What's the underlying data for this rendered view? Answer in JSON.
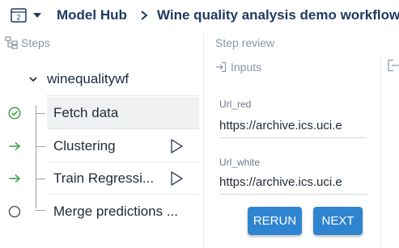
{
  "header": {
    "hub_title": "Model Hub",
    "workflow_title": "Wine quality analysis demo workflow"
  },
  "steps_panel": {
    "title": "Steps",
    "root_label": "winequalitywf",
    "steps": [
      {
        "label": "Fetch data",
        "status": "completed"
      },
      {
        "label": "Clustering",
        "status": "pending-run"
      },
      {
        "label": "Train Regressi...",
        "status": "pending-run"
      },
      {
        "label": "Merge predictions ...",
        "status": "not-started"
      }
    ]
  },
  "review": {
    "title": "Step review",
    "inputs_title": "Inputs",
    "fields": [
      {
        "label": "Url_red",
        "value": "https://archive.ics.uci.e"
      },
      {
        "label": "Url_white",
        "value": "https://archive.ics.uci.e"
      }
    ],
    "rerun_label": "RERUN",
    "next_label": "NEXT"
  },
  "colors": {
    "brand": "#1e3a5f",
    "accent": "#2f84d0",
    "success": "#2e9e3b"
  }
}
